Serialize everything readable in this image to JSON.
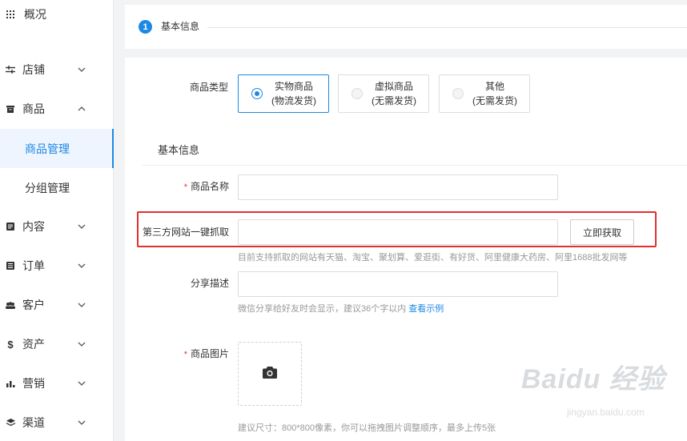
{
  "sidebar": {
    "items": [
      {
        "label": "概况",
        "icon": "grid-icon"
      },
      {
        "label": "店铺",
        "icon": "sliders-icon"
      },
      {
        "label": "商品",
        "icon": "box-icon"
      },
      {
        "label": "商品管理"
      },
      {
        "label": "分组管理"
      },
      {
        "label": "内容",
        "icon": "content-icon"
      },
      {
        "label": "订单",
        "icon": "order-icon"
      },
      {
        "label": "客户",
        "icon": "users-icon"
      },
      {
        "label": "资产",
        "icon": "dollar-icon"
      },
      {
        "label": "营销",
        "icon": "bar-chart-icon"
      },
      {
        "label": "渠道",
        "icon": "layers-icon"
      }
    ]
  },
  "step": {
    "number": "1",
    "label": "基本信息"
  },
  "form": {
    "product_type": {
      "label": "商品类型",
      "options": [
        {
          "title": "实物商品",
          "sub": "(物流发货)",
          "selected": true
        },
        {
          "title": "虚拟商品",
          "sub": "(无需发货)",
          "selected": false
        },
        {
          "title": "其他",
          "sub": "(无需发货)",
          "selected": false
        }
      ]
    },
    "section_title": "基本信息",
    "name": {
      "required_mark": "*",
      "label": "商品名称",
      "value": ""
    },
    "fetch": {
      "label": "第三方网站一键抓取",
      "value": "",
      "button": "立即获取",
      "hint": "目前支持抓取的网站有天猫、淘宝、聚划算、爱逛街、有好货、阿里健康大药房、阿里1688批发网等"
    },
    "share": {
      "label": "分享描述",
      "value": "",
      "hint": "微信分享给好友时会显示，建议36个字以内",
      "link": "查看示例"
    },
    "images": {
      "required_mark": "*",
      "label": "商品图片",
      "hint": "建议尺寸：800*800像素，你可以拖拽图片调整顺序，最多上传5张"
    }
  },
  "watermark": {
    "brand": "Baidu 经验",
    "url": "jingyan.baidu.com"
  },
  "colors": {
    "accent": "#1e88e5",
    "highlight": "#e0302f",
    "required": "#ee3333"
  }
}
